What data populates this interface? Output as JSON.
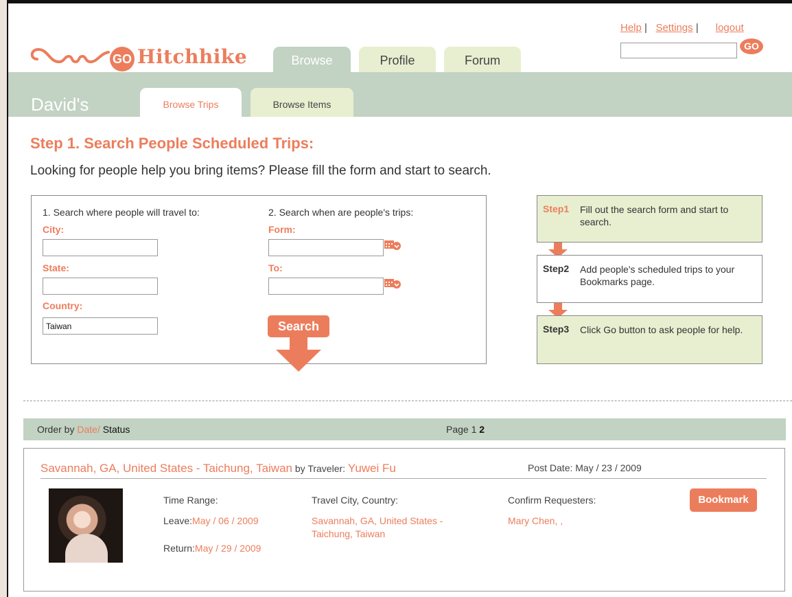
{
  "header": {
    "logo_text": "Hitchhike",
    "logo_go": "GO",
    "main_tabs": [
      {
        "label": "Browse",
        "active": true
      },
      {
        "label": "Profile",
        "active": false
      },
      {
        "label": "Forum",
        "active": false
      }
    ],
    "links": {
      "help": "Help",
      "settings": "Settings",
      "logout": "logout",
      "separator": "|"
    },
    "search_value": "",
    "go_label": "GO"
  },
  "subheader": {
    "user_label": "David's",
    "sub_tabs": [
      {
        "label": "Browse Trips",
        "active": true
      },
      {
        "label": "Browse Items",
        "active": false
      }
    ]
  },
  "main": {
    "heading": "Step 1. Search People Scheduled Trips:",
    "intro": "Looking for people help you bring items? Please fill the form and start to search."
  },
  "form": {
    "section1_label": "1. Search where people will travel to:",
    "city_label": "City:",
    "city_value": "",
    "state_label": "State:",
    "state_value": "",
    "country_label": "Country:",
    "country_value": "Taiwan",
    "section2_label": "2. Search when are people's trips:",
    "from_label": "Form:",
    "from_value": "",
    "to_label": "To:",
    "to_value": "",
    "search_label": "Search"
  },
  "steps": [
    {
      "tag": "Step1",
      "text": "Fill out the search form and start to search."
    },
    {
      "tag": "Step2",
      "text": "Add people's scheduled trips to your Bookmarks page."
    },
    {
      "tag": "Step3",
      "text": "Click Go button to ask people for help."
    }
  ],
  "results_bar": {
    "order_prefix": "Order by ",
    "order_date": "Date",
    "order_sep": "/",
    "order_status": " Status",
    "page_label": "Page 1 ",
    "page_current": "2"
  },
  "result": {
    "route": "Savannah, GA, United States - Taichung, Taiwan",
    "by_label": " by Traveler: ",
    "traveler": "Yuwei Fu",
    "post_date": "Post Date: May / 23 / 2009",
    "time_range_label": "Time Range:",
    "leave_label": "Leave:",
    "leave_value": "May / 06 / 2009",
    "return_label": "Return:",
    "return_value": "May / 29 / 2009",
    "travel_city_label": "Travel City, Country:",
    "travel_city_line1": "Savannah, GA, United States -",
    "travel_city_line2": "Taichung, Taiwan",
    "requesters_label": "Confirm Requesters:",
    "requesters_value": "Mary Chen, ,",
    "bookmark_label": "Bookmark"
  },
  "colors": {
    "accent": "#ec7d5c",
    "band_green": "#c2d2c3",
    "tab_light": "#e7efd0"
  }
}
